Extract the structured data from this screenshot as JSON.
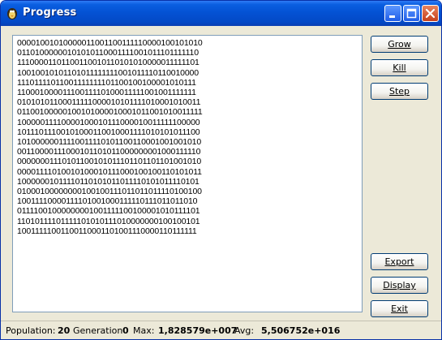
{
  "window": {
    "title": "Progress"
  },
  "output_lines": [
    "00001001010000011001100111110000100101010",
    "01101000000101010110001111001011101111110",
    "11100001101100110010110101010000011111101",
    "10010010101101011111111001011110110010000",
    "11101111011001111111101100100100001010111",
    "11000100001110011110100011111001001111111",
    "01010101100011111000010101111010001010011",
    "01100100000100101000010001011001010011111",
    "10000011110000100010111000010011111100000",
    "10111011100101000110010001111010101011100",
    "10100000011110011110101100110001001001010",
    "00110000111000101101011000000001000111110",
    "00000001110101100101011101101101101001010",
    "00001111010010100010111000100100110101011",
    "10000001011110110101011011110101011110101",
    "01000100000000100100111011011011110100100",
    "10011110000111101001000111110111011011010",
    "01111001000000001001111100100001010111101",
    "11010111101111101010111010000000100100101",
    "10011111001100110001101001110000110111111"
  ],
  "buttons": {
    "grow": "Grow",
    "kill": "Kill",
    "step": "Step",
    "export": "Export",
    "display": "Display",
    "exit": "Exit"
  },
  "status": {
    "population_label": "Population:",
    "population_value": "20",
    "generation_label": "Generation",
    "generation_value": "0",
    "max_label": "Max:",
    "max_value": "1,828579e+007",
    "avg_label": "Avg:",
    "avg_value": "5,506752e+016"
  }
}
